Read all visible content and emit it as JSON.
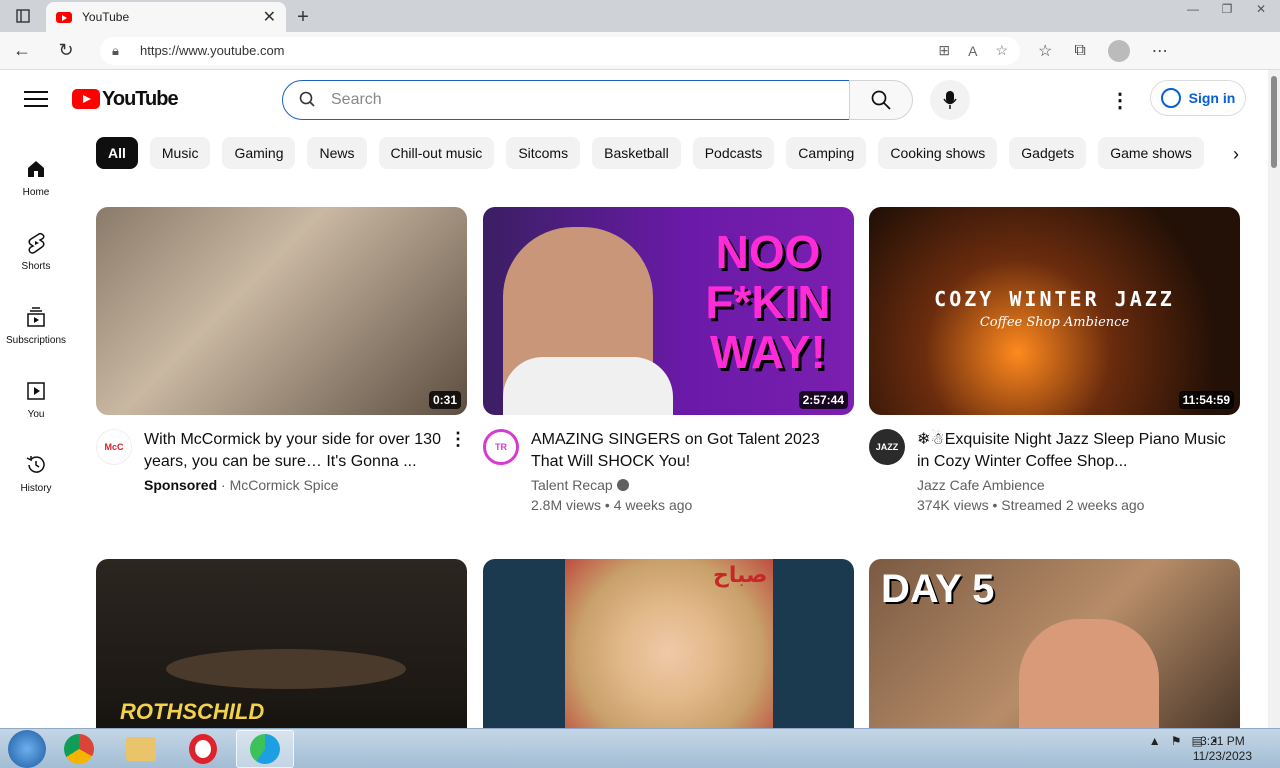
{
  "browser": {
    "tab_title": "YouTube",
    "url": "https://www.youtube.com"
  },
  "header": {
    "logo_text": "YouTube",
    "search_placeholder": "Search",
    "signin_label": "Sign in"
  },
  "sidebar": {
    "items": [
      {
        "label": "Home",
        "icon": "home-icon"
      },
      {
        "label": "Shorts",
        "icon": "shorts-icon"
      },
      {
        "label": "Subscriptions",
        "icon": "subscriptions-icon"
      },
      {
        "label": "You",
        "icon": "library-icon"
      },
      {
        "label": "History",
        "icon": "history-icon"
      }
    ]
  },
  "chips": [
    "All",
    "Music",
    "Gaming",
    "News",
    "Chill-out music",
    "Sitcoms",
    "Basketball",
    "Podcasts",
    "Camping",
    "Cooking shows",
    "Gadgets",
    "Game shows"
  ],
  "videos": [
    {
      "title": "With McCormick by your side for over 130 years, you can be sure… It's Gonna ...",
      "sponsored": "Sponsored",
      "channel": "McCormick Spice",
      "duration": "0:31"
    },
    {
      "title": "AMAZING SINGERS on Got Talent 2023 That Will SHOCK You!",
      "channel": "Talent Recap",
      "stats": "2.8M views • 4 weeks ago",
      "duration": "2:57:44",
      "thumb_text": "NOO F*KIN WAY!"
    },
    {
      "title": "❄☃Exquisite Night Jazz Sleep Piano Music in Cozy Winter Coffee Shop...",
      "channel": "Jazz Cafe Ambience",
      "stats": "374K views • Streamed 2 weeks ago",
      "duration": "11:54:59",
      "thumb_text": "COZY WINTER JAZZ",
      "thumb_subtext": "Coffee Shop Ambience"
    },
    {
      "thumb_text": "ROTHSCHILD"
    },
    {
      "thumb_text": "صباح"
    },
    {
      "thumb_text": "DAY 5"
    }
  ],
  "taskbar": {
    "time": "3:21 PM",
    "date": "11/23/2023"
  },
  "colors": {
    "brand_red": "#ff0000",
    "link_blue": "#065fd4",
    "search_focus": "#1c62b9"
  }
}
